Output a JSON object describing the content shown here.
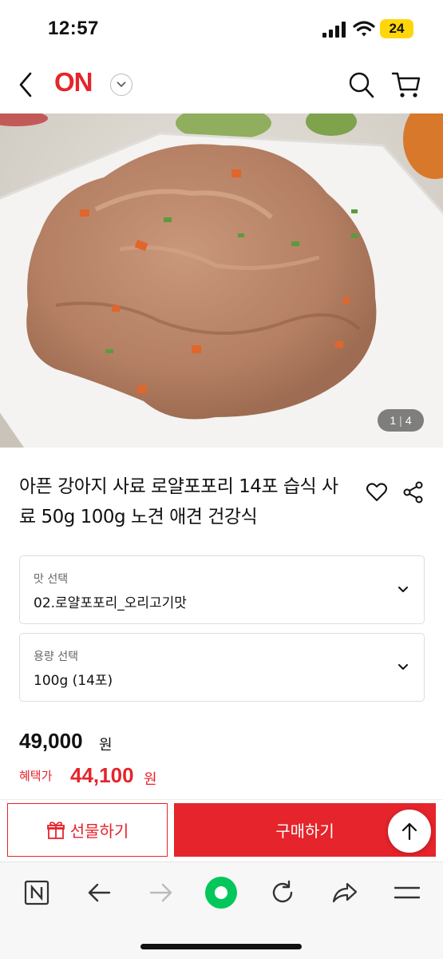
{
  "status_bar": {
    "time": "12:57",
    "battery": "24",
    "icons": [
      "signal-icon",
      "wifi-icon",
      "battery-icon"
    ]
  },
  "header": {
    "brand": "ON",
    "brand_color": "#e5242b",
    "icons": [
      "back-icon",
      "chevron-down-icon",
      "search-icon",
      "cart-icon"
    ]
  },
  "gallery": {
    "current": "1",
    "total": "4"
  },
  "product": {
    "title": "아픈 강아지 사료 로얄포포리 14포 습식 사료 50g 100g 노견 애견 건강식",
    "icons": [
      "heart-icon",
      "share-icon"
    ]
  },
  "options": [
    {
      "label": "맛 선택",
      "value": "02.로얄포포리_오리고기맛"
    },
    {
      "label": "용량 선택",
      "value": "100g (14포)"
    }
  ],
  "price": {
    "original": "49,000",
    "original_unit": "원",
    "benefit_label": "혜택가",
    "benefit": "44,100",
    "benefit_unit": "원"
  },
  "actions": {
    "gift_label": "선물하기",
    "buy_label": "구매하기"
  },
  "browser_toolbar": {
    "icons": [
      "naver-n-icon",
      "back-arrow-icon",
      "forward-arrow-icon",
      "green-dot-icon",
      "reload-icon",
      "share-arrow-icon",
      "menu-icon"
    ]
  },
  "colors": {
    "accent": "#e5242b",
    "battery": "#ffd60a",
    "naver_green": "#03c75a"
  }
}
